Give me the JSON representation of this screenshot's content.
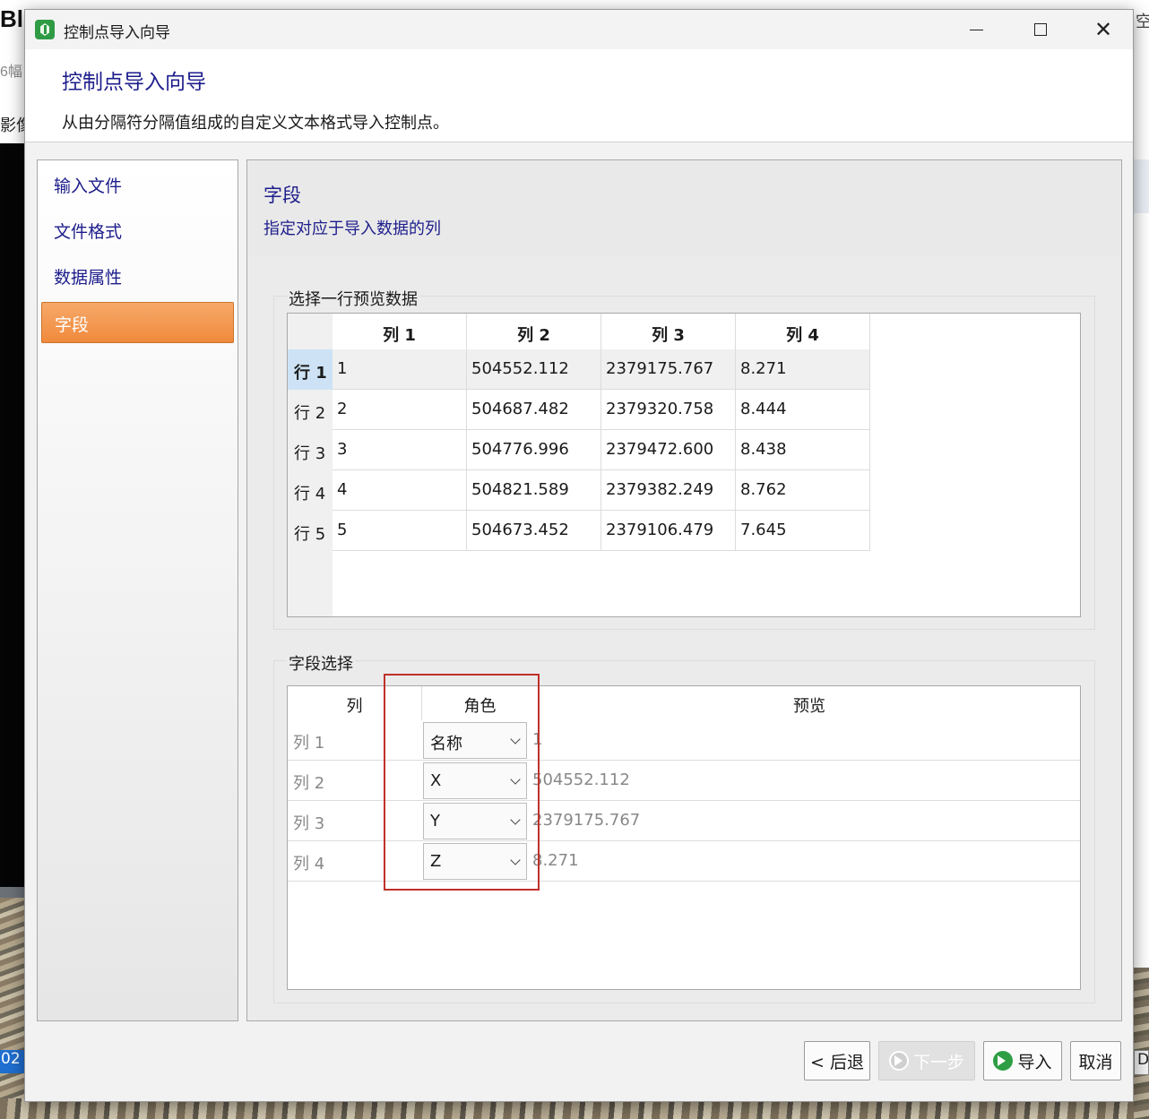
{
  "background": {
    "app_title_fragment": "Bl",
    "app_sub_fragment": "6幅",
    "app_tab_fragment": "影像",
    "right_fragment": "空",
    "bottom_left_badge": "02",
    "bottom_right_badge": "D"
  },
  "window": {
    "title": "控制点导入向导"
  },
  "header": {
    "title": "控制点导入向导",
    "description": "从由分隔符分隔值组成的自定义文本格式导入控制点。"
  },
  "nav": {
    "items": [
      {
        "label": "输入文件",
        "active": false
      },
      {
        "label": "文件格式",
        "active": false
      },
      {
        "label": "数据属性",
        "active": false
      },
      {
        "label": "字段",
        "active": true
      }
    ]
  },
  "page": {
    "title": "字段",
    "subtitle": "指定对应于导入数据的列"
  },
  "preview": {
    "group_label": "选择一行预览数据",
    "columns": [
      "列 1",
      "列 2",
      "列 3",
      "列 4"
    ],
    "rows": [
      {
        "header": "行 1",
        "cells": [
          "1",
          "504552.112",
          "2379175.767",
          "8.271"
        ],
        "selected": true
      },
      {
        "header": "行 2",
        "cells": [
          "2",
          "504687.482",
          "2379320.758",
          "8.444"
        ],
        "selected": false
      },
      {
        "header": "行 3",
        "cells": [
          "3",
          "504776.996",
          "2379472.600",
          "8.438"
        ],
        "selected": false
      },
      {
        "header": "行 4",
        "cells": [
          "4",
          "504821.589",
          "2379382.249",
          "8.762"
        ],
        "selected": false
      },
      {
        "header": "行 5",
        "cells": [
          "5",
          "504673.452",
          "2379106.479",
          "7.645"
        ],
        "selected": false
      }
    ]
  },
  "fields": {
    "group_label": "字段选择",
    "headers": {
      "column": "列",
      "role": "角色",
      "preview": "预览"
    },
    "rows": [
      {
        "column": "列 1",
        "role": "名称",
        "preview": "1"
      },
      {
        "column": "列 2",
        "role": "X",
        "preview": "504552.112"
      },
      {
        "column": "列 3",
        "role": "Y",
        "preview": "2379175.767"
      },
      {
        "column": "列 4",
        "role": "Z",
        "preview": "8.271"
      }
    ]
  },
  "buttons": {
    "back": "< 后退",
    "next": "下一步",
    "import": "导入",
    "cancel": "取消"
  },
  "colors": {
    "accent_title": "#1d1d8c",
    "nav_active": "#f08a3c",
    "highlight_box": "#c0302a",
    "selected_row_header": "#cde3f5"
  }
}
